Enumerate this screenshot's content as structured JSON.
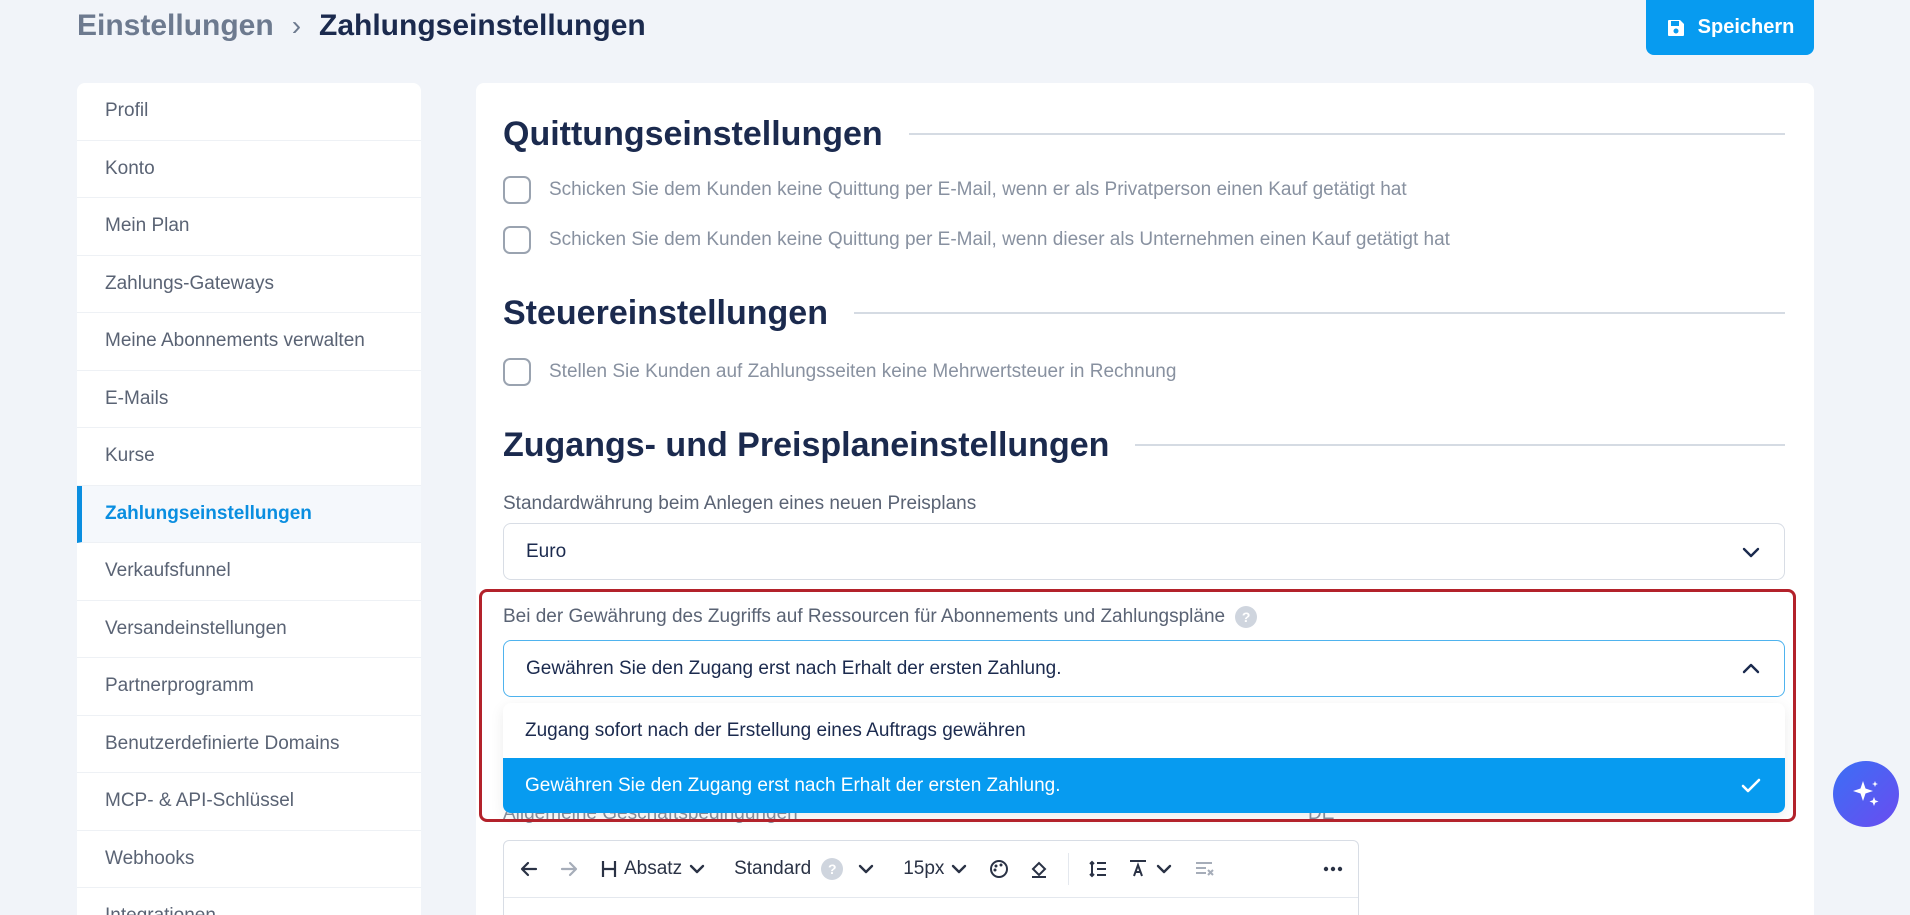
{
  "breadcrumb": {
    "root": "Einstellungen",
    "separator": "›",
    "current": "Zahlungseinstellungen"
  },
  "save_button": {
    "label": "Speichern",
    "icon": "save-icon"
  },
  "sidebar": {
    "items": [
      {
        "label": "Profil"
      },
      {
        "label": "Konto"
      },
      {
        "label": "Mein Plan"
      },
      {
        "label": "Zahlungs-Gateways"
      },
      {
        "label": "Meine Abonnements verwalten"
      },
      {
        "label": "E-Mails"
      },
      {
        "label": "Kurse"
      },
      {
        "label": "Zahlungseinstellungen",
        "active": true
      },
      {
        "label": "Verkaufsfunnel"
      },
      {
        "label": "Versandeinstellungen"
      },
      {
        "label": "Partnerprogramm"
      },
      {
        "label": "Benutzerdefinierte Domains"
      },
      {
        "label": "MCP- & API-Schlüssel"
      },
      {
        "label": "Webhooks"
      },
      {
        "label": "Integrationen"
      }
    ]
  },
  "receipts": {
    "title": "Quittungseinstellungen",
    "option_private": "Schicken Sie dem Kunden keine Quittung per E-Mail, wenn er als Privatperson einen Kauf getätigt hat",
    "option_business": "Schicken Sie dem Kunden keine Quittung per E-Mail, wenn dieser als Unternehmen einen Kauf getätigt hat"
  },
  "tax": {
    "title": "Steuereinstellungen",
    "option_no_vat": "Stellen Sie Kunden auf Zahlungsseiten keine Mehrwertsteuer in Rechnung"
  },
  "access": {
    "title": "Zugangs- und Preisplaneinstellungen",
    "currency_label": "Standardwährung beim Anlegen eines neuen Preisplans",
    "currency_value": "Euro",
    "grant_label": "Bei der Gewährung des Zugriffs auf Ressourcen für Abonnements und Zahlungspläne",
    "grant_value": "Gewähren Sie den Zugang erst nach Erhalt der ersten Zahlung.",
    "grant_options": [
      "Zugang sofort nach der Erstellung eines Auftrags gewähren",
      "Gewähren Sie den Zugang erst nach Erhalt der ersten Zahlung."
    ],
    "terms_label_partial": "Allgemeine Geschäftsbedingungen",
    "lang_partial": "DE"
  },
  "editor_toolbar": {
    "heading_label": "Absatz",
    "font_label": "Standard",
    "size_label": "15px"
  },
  "colors": {
    "accent": "#079bf0",
    "highlight": "#b3222b",
    "title": "#1b2a4e"
  }
}
